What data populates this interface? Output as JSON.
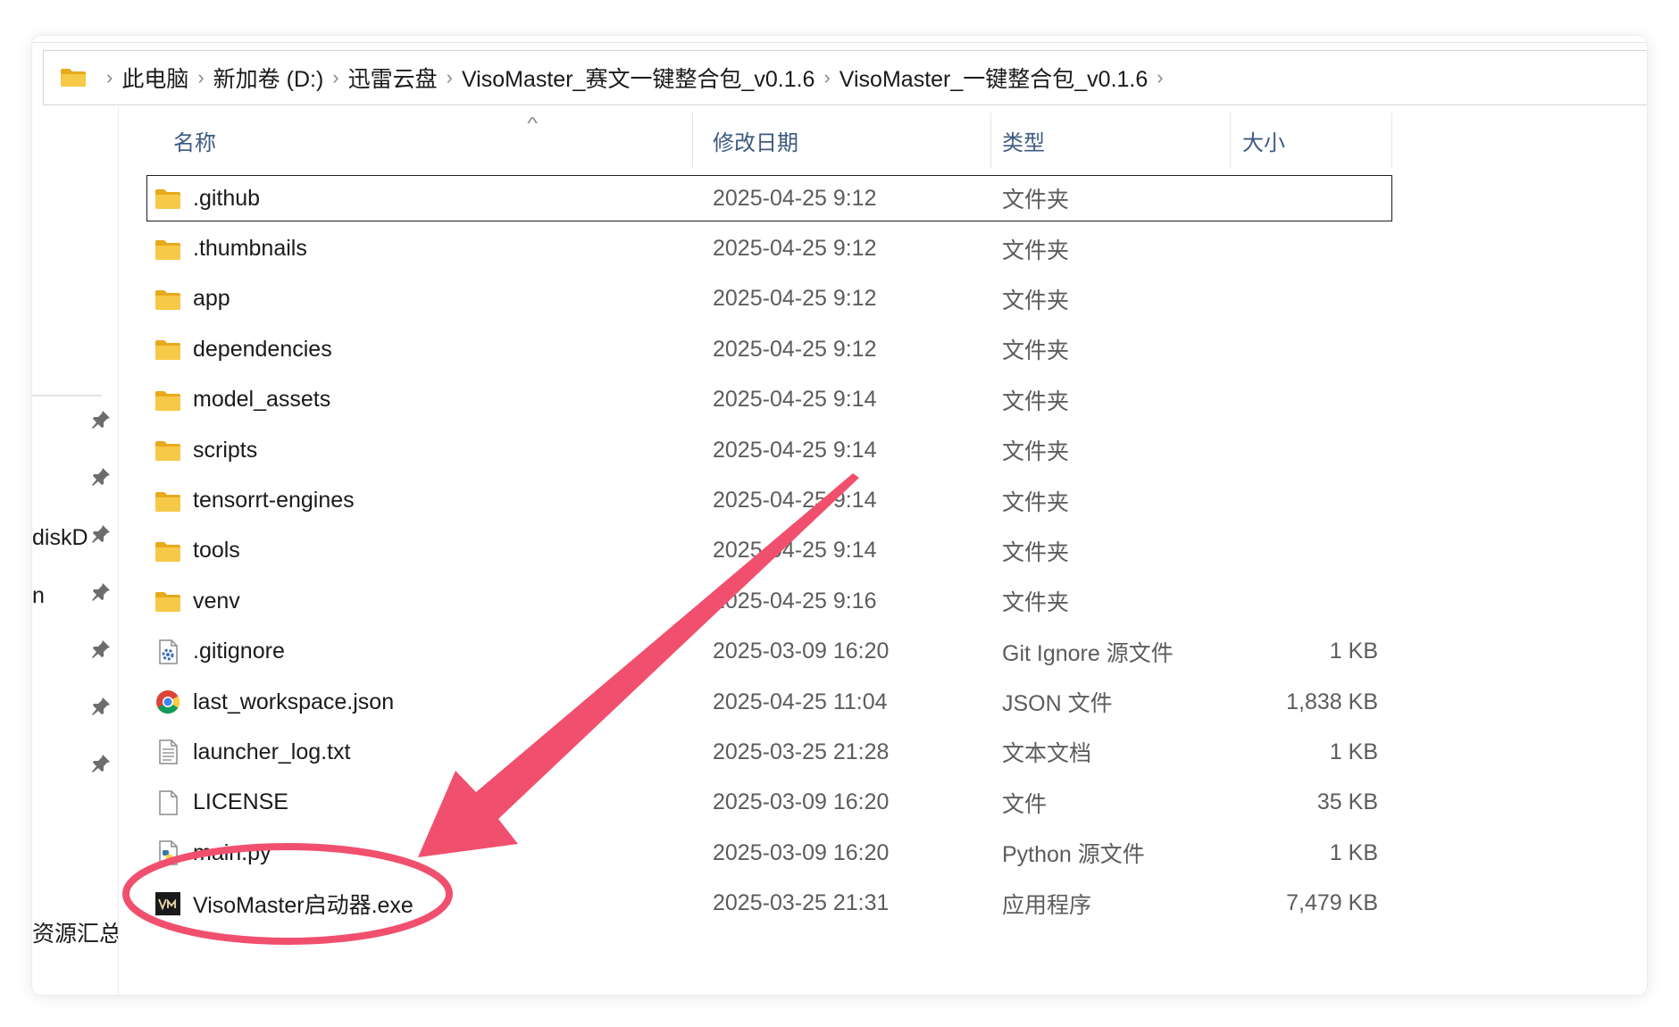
{
  "breadcrumb": [
    "此电脑",
    "新加卷 (D:)",
    "迅雷云盘",
    "VisoMaster_赛文一键整合包_v0.1.6",
    "VisoMaster_一键整合包_v0.1.6"
  ],
  "nav": {
    "partial_item_1": "diskDr",
    "partial_item_2": "n",
    "partial_item_3": "资源汇总"
  },
  "columns": {
    "name": "名称",
    "date": "修改日期",
    "type": "类型",
    "size": "大小"
  },
  "files": [
    {
      "name": ".github",
      "date": "2025-04-25 9:12",
      "type": "文件夹",
      "size": "",
      "icon": "folder-icon"
    },
    {
      "name": ".thumbnails",
      "date": "2025-04-25 9:12",
      "type": "文件夹",
      "size": "",
      "icon": "folder-icon"
    },
    {
      "name": "app",
      "date": "2025-04-25 9:12",
      "type": "文件夹",
      "size": "",
      "icon": "folder-icon"
    },
    {
      "name": "dependencies",
      "date": "2025-04-25 9:12",
      "type": "文件夹",
      "size": "",
      "icon": "folder-icon"
    },
    {
      "name": "model_assets",
      "date": "2025-04-25 9:14",
      "type": "文件夹",
      "size": "",
      "icon": "folder-icon"
    },
    {
      "name": "scripts",
      "date": "2025-04-25 9:14",
      "type": "文件夹",
      "size": "",
      "icon": "folder-icon"
    },
    {
      "name": "tensorrt-engines",
      "date": "2025-04-25 9:14",
      "type": "文件夹",
      "size": "",
      "icon": "folder-icon"
    },
    {
      "name": "tools",
      "date": "2025-04-25 9:14",
      "type": "文件夹",
      "size": "",
      "icon": "folder-icon"
    },
    {
      "name": "venv",
      "date": "2025-04-25 9:16",
      "type": "文件夹",
      "size": "",
      "icon": "folder-icon"
    },
    {
      "name": ".gitignore",
      "date": "2025-03-09 16:20",
      "type": "Git Ignore 源文件",
      "size": "1 KB",
      "icon": "settings-file-icon"
    },
    {
      "name": "last_workspace.json",
      "date": "2025-04-25 11:04",
      "type": "JSON 文件",
      "size": "1,838 KB",
      "icon": "chrome-icon"
    },
    {
      "name": "launcher_log.txt",
      "date": "2025-03-25 21:28",
      "type": "文本文档",
      "size": "1 KB",
      "icon": "text-file-icon"
    },
    {
      "name": "LICENSE",
      "date": "2025-03-09 16:20",
      "type": "文件",
      "size": "35 KB",
      "icon": "blank-file-icon"
    },
    {
      "name": "main.py",
      "date": "2025-03-09 16:20",
      "type": "Python 源文件",
      "size": "1 KB",
      "icon": "python-file-icon"
    },
    {
      "name": "VisoMaster启动器.exe",
      "date": "2025-03-25 21:31",
      "type": "应用程序",
      "size": "7,479 KB",
      "icon": "visomaster-app-icon"
    }
  ],
  "colors": {
    "annotation": "#f0506e",
    "header_text": "#3d5a80",
    "folder": "#f7c948"
  }
}
